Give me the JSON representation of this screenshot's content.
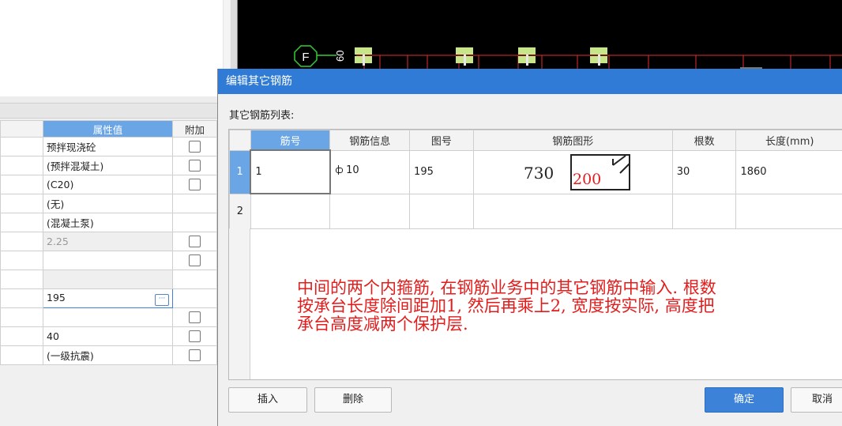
{
  "property_panel": {
    "headers": {
      "value": "属性值",
      "add": "附加"
    },
    "rows": [
      {
        "value": "预拌现浇砼",
        "checkbox": true
      },
      {
        "value": "(预拌混凝土)",
        "checkbox": true
      },
      {
        "value": "(C20)",
        "checkbox": true
      },
      {
        "value": "(无)",
        "checkbox": false
      },
      {
        "value": "(混凝土泵)",
        "checkbox": false
      },
      {
        "value": "2.25",
        "checkbox": true,
        "grey": true
      },
      {
        "value": "",
        "checkbox": true
      },
      {
        "value": "",
        "checkbox": false,
        "grey": true
      },
      {
        "value": "195",
        "checkbox": false,
        "active": true
      },
      {
        "value": "",
        "checkbox": true
      },
      {
        "value": "40",
        "checkbox": true
      },
      {
        "value": "(一级抗震)",
        "checkbox": true
      }
    ]
  },
  "cad": {
    "axis_label": "F",
    "dimension_text": "60"
  },
  "dialog": {
    "title": "编辑其它钢筋",
    "list_label": "其它钢筋列表:",
    "columns": [
      "筋号",
      "钢筋信息",
      "图号",
      "钢筋图形",
      "根数",
      "长度(mm)"
    ],
    "rows": [
      {
        "row_no": "1",
        "bar_no": "1",
        "info": " 10",
        "shape_no": "195",
        "shape_dim1": "730",
        "shape_dim2": "200",
        "count": "30",
        "length": "1860"
      },
      {
        "row_no": "2",
        "bar_no": "",
        "info": "",
        "shape_no": "",
        "shape_dim1": "",
        "shape_dim2": "",
        "count": "",
        "length": ""
      }
    ],
    "annotation": "中间的两个内箍筋, 在钢筋业务中的其它钢筋中输入. 根数\n按承台长度除间距加1, 然后再乘上2, 宽度按实际, 高度把\n承台高度减两个保护层.",
    "buttons": {
      "insert": "插入",
      "delete": "删除",
      "ok": "确定",
      "cancel": "取消"
    }
  },
  "colors": {
    "title_bar": "#2f7bd6",
    "header_selected": "#6aa6e6",
    "annotation": "#e21d1d",
    "cad_red": "#e03030",
    "cad_green": "#33cc33",
    "cad_pad": "#c8e58a"
  }
}
